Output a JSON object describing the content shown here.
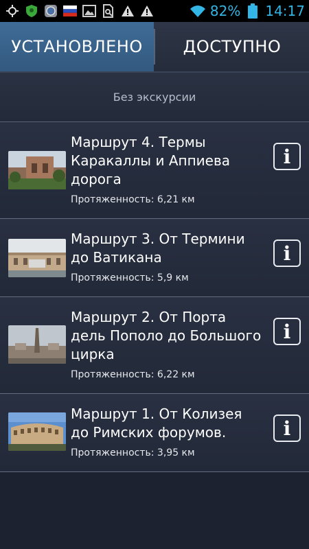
{
  "status_bar": {
    "battery_percent": "82%",
    "time": "14:17",
    "left_icons": [
      "gps-icon",
      "shield-icon",
      "browser-icon",
      "flag-icon",
      "image-icon",
      "search-file-icon",
      "warning-icon",
      "warning-icon"
    ],
    "right_icons": [
      "wifi-icon",
      "battery-icon"
    ]
  },
  "tabs": [
    {
      "label": "УСТАНОВЛЕНО",
      "active": true
    },
    {
      "label": "ДОСТУПНО",
      "active": false
    }
  ],
  "section": {
    "title": "Без экскурсии"
  },
  "routes": [
    {
      "title": "Маршрут 4. Термы Каракаллы и Аппиева дорога",
      "length": "Протяженность: 6,21 км",
      "thumb": "baths-of-caracalla-image"
    },
    {
      "title": "Маршрут 3. От Термини до Ватикана",
      "length": "Протяженность: 5,9 км",
      "thumb": "termini-fountain-image"
    },
    {
      "title": "Маршрут 2. От Порта дель Пополо до Большого цирка",
      "length": "Протяженность: 6,22 км",
      "thumb": "piazza-del-popolo-obelisk-image"
    },
    {
      "title": "Маршрут 1. От Колизея до Римских форумов.",
      "length": "Протяженность: 3,95 км",
      "thumb": "colosseum-image"
    }
  ],
  "colors": {
    "accent": "#33b5e5",
    "tab_active": "#3f6c96",
    "background": "#1c2230"
  }
}
